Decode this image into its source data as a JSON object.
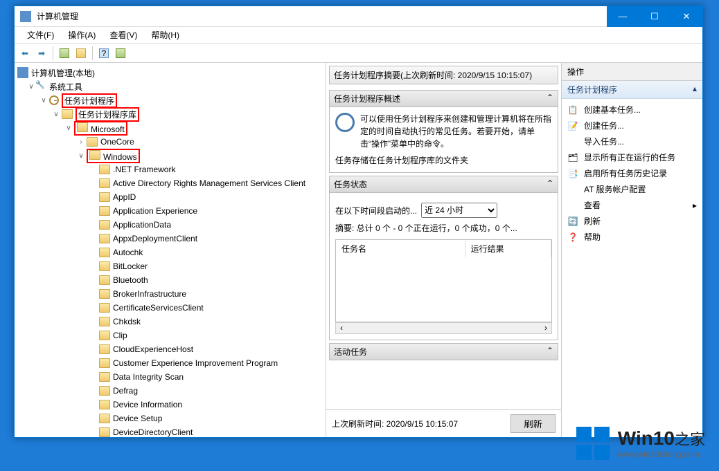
{
  "window": {
    "title": "计算机管理"
  },
  "menubar": [
    "文件(F)",
    "操作(A)",
    "查看(V)",
    "帮助(H)"
  ],
  "tree": {
    "root": "计算机管理(本地)",
    "node_system_tools": "系统工具",
    "node_task_scheduler": "任务计划程序",
    "node_task_lib": "任务计划程序库",
    "node_microsoft": "Microsoft",
    "node_onecore": "OneCore",
    "node_windows": "Windows",
    "windows_children": [
      ".NET Framework",
      "Active Directory Rights Management Services Client",
      "AppID",
      "Application Experience",
      "ApplicationData",
      "AppxDeploymentClient",
      "Autochk",
      "BitLocker",
      "Bluetooth",
      "BrokerInfrastructure",
      "CertificateServicesClient",
      "Chkdsk",
      "Clip",
      "CloudExperienceHost",
      "Customer Experience Improvement Program",
      "Data Integrity Scan",
      "Defrag",
      "Device Information",
      "Device Setup",
      "DeviceDirectoryClient"
    ]
  },
  "middle": {
    "summary_header": "任务计划程序摘要(上次刷新时间: 2020/9/15 10:15:07)",
    "overview_title": "任务计划程序概述",
    "overview_text": "可以使用任务计划程序来创建和管理计算机将在所指定的时间自动执行的常见任务。若要开始，请单击“操作”菜单中的命令。",
    "overview_text2": "任务存储在任务计划程序库的文件夹",
    "status_title": "任务状态",
    "status_label": "在以下时间段启动的...",
    "status_dropdown": "近 24 小时",
    "status_summary": "摘要: 总计 0 个 - 0 个正在运行，0 个成功，0 个...",
    "table_col1": "任务名",
    "table_col2": "运行结果",
    "active_title": "活动任务",
    "footer_time": "上次刷新时间: 2020/9/15 10:15:07",
    "refresh_btn": "刷新"
  },
  "actions": {
    "panel_title": "操作",
    "section_title": "任务计划程序",
    "items": [
      {
        "icon": "📋",
        "label": "创建基本任务..."
      },
      {
        "icon": "📝",
        "label": "创建任务..."
      },
      {
        "icon": "",
        "label": "导入任务..."
      },
      {
        "icon": "🗂",
        "label": "显示所有正在运行的任务"
      },
      {
        "icon": "📑",
        "label": "启用所有任务历史记录"
      },
      {
        "icon": "",
        "label": "AT 服务帐户配置"
      },
      {
        "icon": "",
        "label": "查看",
        "submenu": true
      },
      {
        "icon": "🔄",
        "label": "刷新"
      },
      {
        "icon": "❓",
        "label": "帮助"
      }
    ]
  },
  "watermark": {
    "big": "Win10",
    "suffix": "之家",
    "url": "www.win10xitong.com"
  }
}
